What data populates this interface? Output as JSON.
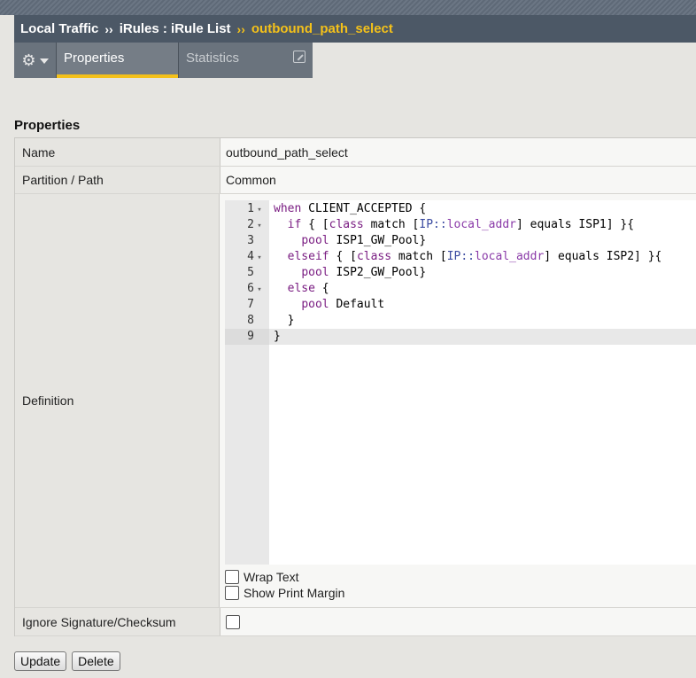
{
  "breadcrumb": {
    "section": "Local Traffic",
    "separator": "››",
    "parent": "iRules : iRule List",
    "current": "outbound_path_select"
  },
  "tabs": [
    {
      "label": "Properties",
      "active": true
    },
    {
      "label": "Statistics",
      "active": false
    }
  ],
  "section_title": "Properties",
  "fields": {
    "name": {
      "label": "Name",
      "value": "outbound_path_select"
    },
    "partition": {
      "label": "Partition / Path",
      "value": "Common"
    },
    "definition": {
      "label": "Definition"
    },
    "ignore_sig": {
      "label": "Ignore Signature/Checksum",
      "checked": false
    }
  },
  "editor": {
    "lines": [
      "when CLIENT_ACCEPTED {",
      "  if { [class match [IP::local_addr] equals ISP1] }{",
      "    pool ISP1_GW_Pool}",
      "  elseif { [class match [IP::local_addr] equals ISP2] }{",
      "    pool ISP2_GW_Pool}",
      "  else {",
      "    pool Default",
      "  }",
      "}"
    ],
    "line_numbers": [
      "1",
      "2",
      "3",
      "4",
      "5",
      "6",
      "7",
      "8",
      "9"
    ],
    "active_line": 9,
    "wrap_text_label": "Wrap Text",
    "wrap_text_checked": false,
    "print_margin_label": "Show Print Margin",
    "print_margin_checked": false
  },
  "buttons": {
    "update": "Update",
    "delete": "Delete"
  },
  "colors": {
    "accent": "#f4c11a",
    "title_bar": "#4c5866",
    "keyword": "#7a1d82"
  }
}
